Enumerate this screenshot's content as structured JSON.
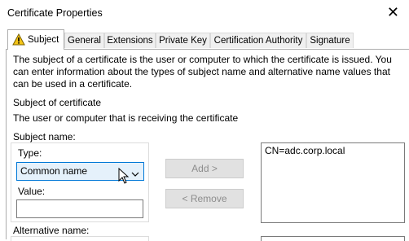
{
  "window": {
    "title": "Certificate Properties",
    "close_glyph": "✕"
  },
  "tabs": [
    {
      "label": "Subject",
      "active": true
    },
    {
      "label": "General"
    },
    {
      "label": "Extensions"
    },
    {
      "label": "Private Key"
    },
    {
      "label": "Certification Authority"
    },
    {
      "label": "Signature"
    }
  ],
  "description": [
    "The subject of a certificate is the user or computer to which the certificate is issued. You",
    "can enter information about the types of subject name and alternative name values that",
    "can be used in a certificate."
  ],
  "section_title": "Subject of certificate",
  "section_desc": "The user or computer that is receiving the certificate",
  "subject_name": {
    "label": "Subject name:",
    "type_label": "Type:",
    "type_value": "Common name",
    "value_label": "Value:",
    "value_input": ""
  },
  "buttons": {
    "add": "Add >",
    "remove": "< Remove"
  },
  "subject_list": [
    "CN=adc.corp.local"
  ],
  "alt_name_label": "Alternative name:",
  "icons": {
    "warning": "warning-icon",
    "dropdown": "chevron-down-icon",
    "cursor": "mouse-cursor"
  }
}
